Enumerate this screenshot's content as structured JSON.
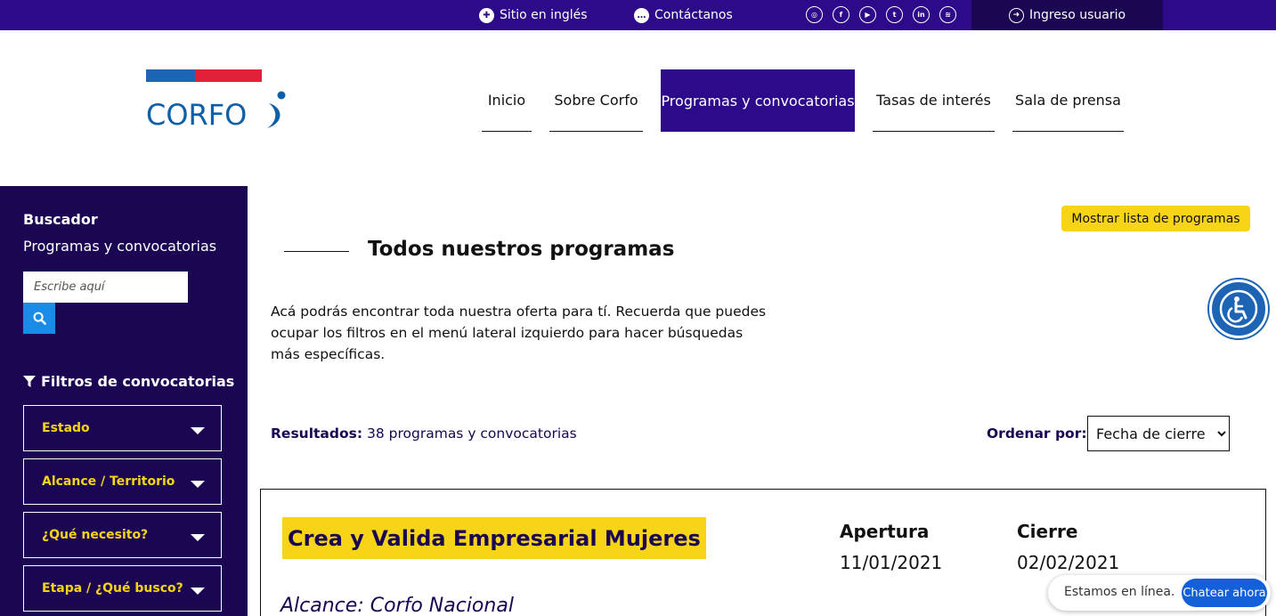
{
  "topbar": {
    "english_label": "Sitio en inglés",
    "contact_label": "Contáctanos",
    "socials": [
      "instagram-icon",
      "facebook-icon",
      "youtube-icon",
      "twitter-icon",
      "linkedin-icon",
      "spotify-icon"
    ],
    "login_label": "Ingreso usuario"
  },
  "logo": {
    "text": "CORFO"
  },
  "nav": {
    "items": [
      {
        "label": "Inicio"
      },
      {
        "label": "Sobre Corfo"
      },
      {
        "label": "Programas y convocatorias",
        "active": true
      },
      {
        "label": "Tasas de interés"
      },
      {
        "label": "Sala de prensa"
      }
    ]
  },
  "sidebar": {
    "title": "Buscador",
    "subtitle": "Programas y convocatorias",
    "search_placeholder": "Escribe aquí",
    "filters_title": "Filtros de convocatorias",
    "filters": [
      {
        "label": "Estado"
      },
      {
        "label": "Alcance / Territorio"
      },
      {
        "label": "¿Qué necesito?"
      },
      {
        "label": "Etapa / ¿Qué busco?"
      }
    ]
  },
  "main": {
    "show_list_label": "Mostrar lista de programas",
    "title": "Todos nuestros programas",
    "intro": "Acá podrás encontrar toda nuestra oferta para tí. Recuerda que puedes ocupar los filtros en el menú lateral izquierdo para hacer búsquedas más específicas.",
    "results_label": "Resultados:",
    "results_value": "38 programas y convocatorias",
    "order_label": "Ordenar por:",
    "order_selected": "Fecha de cierre"
  },
  "card": {
    "title": "Crea y Valida Empresarial Mujeres",
    "open_label": "Apertura",
    "open_date": "11/01/2021",
    "close_label": "Cierre",
    "close_date": "02/02/2021",
    "scope": "Alcance: Corfo Nacional"
  },
  "chat": {
    "status": "Estamos en línea.",
    "button": "Chatear ahora"
  },
  "colors": {
    "brand_purple": "#2d0a8a",
    "sidebar_dark": "#1a0652",
    "accent_yellow": "#f7d416",
    "logo_blue": "#0f5fa8",
    "logo_red": "#e2203a"
  }
}
